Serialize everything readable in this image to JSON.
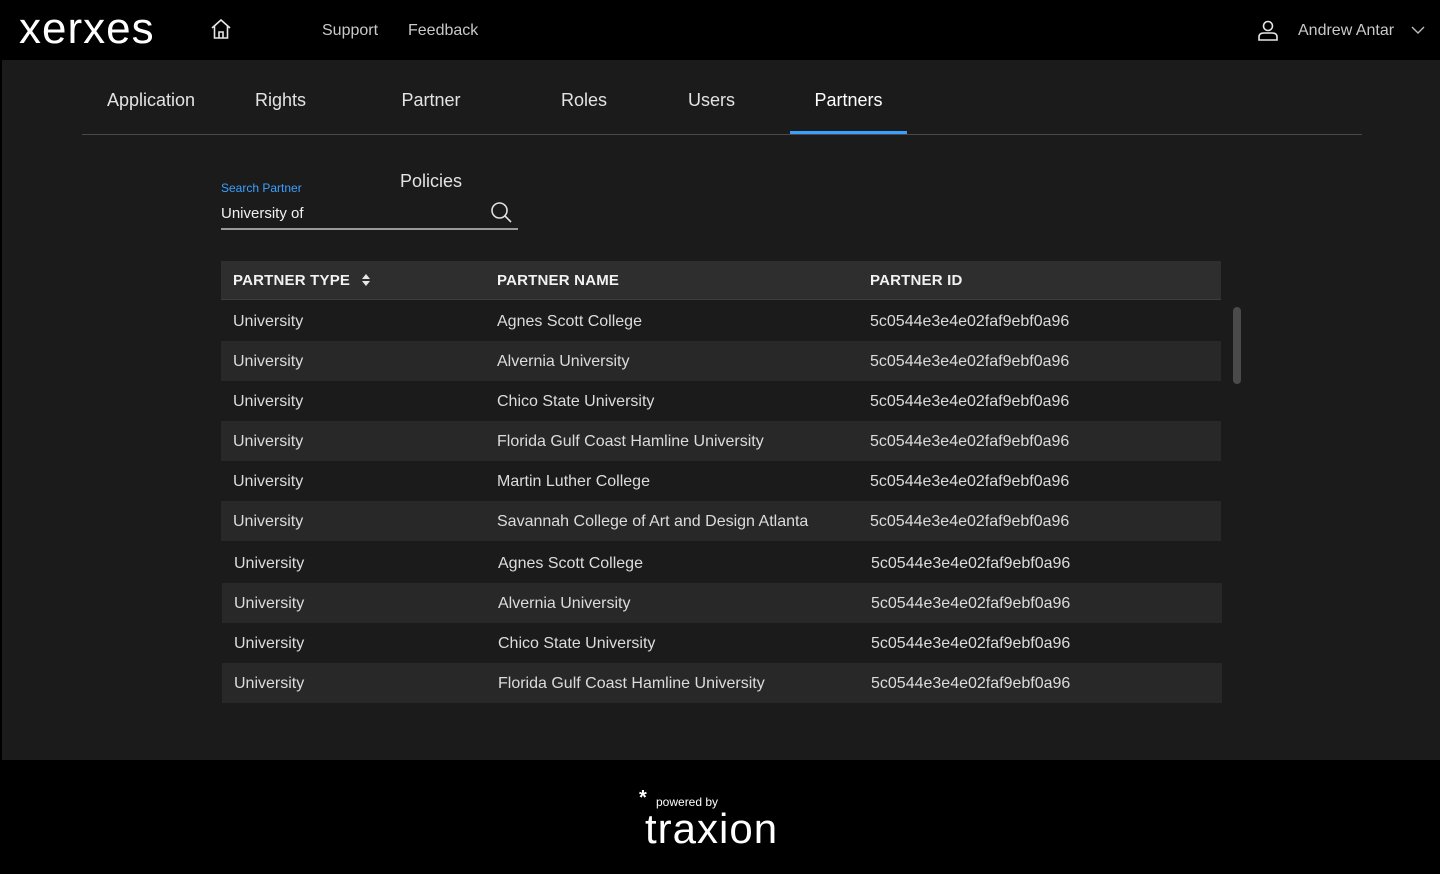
{
  "header": {
    "logo": "xerxes",
    "nav": [
      {
        "label": "Support"
      },
      {
        "label": "Feedback"
      }
    ],
    "user": {
      "name": "Andrew Antar"
    }
  },
  "tabs": [
    {
      "label": "Application"
    },
    {
      "label": "Rights"
    },
    {
      "label": "Partner Policies"
    },
    {
      "label": "Roles"
    },
    {
      "label": "Users"
    },
    {
      "label": "Partners",
      "active": true
    }
  ],
  "search": {
    "label": "Search Partner",
    "value": "University of"
  },
  "table": {
    "columns": [
      {
        "label": "PARTNER TYPE",
        "sortable": true
      },
      {
        "label": "PARTNER NAME"
      },
      {
        "label": "PARTNER ID"
      }
    ],
    "rows": [
      {
        "type": "University",
        "name": "Agnes Scott College",
        "id": "5c0544e3e4e02faf9ebf0a96"
      },
      {
        "type": "University",
        "name": "Alvernia University",
        "id": "5c0544e3e4e02faf9ebf0a96"
      },
      {
        "type": "University",
        "name": "Chico State University",
        "id": "5c0544e3e4e02faf9ebf0a96"
      },
      {
        "type": "University",
        "name": "Florida Gulf Coast Hamline University",
        "id": "5c0544e3e4e02faf9ebf0a96"
      },
      {
        "type": "University",
        "name": "Martin Luther College",
        "id": "5c0544e3e4e02faf9ebf0a96"
      },
      {
        "type": "University",
        "name": "Savannah College of Art and Design Atlanta",
        "id": "5c0544e3e4e02faf9ebf0a96"
      },
      {
        "type": "University",
        "name": "Agnes Scott College",
        "id": "5c0544e3e4e02faf9ebf0a96"
      },
      {
        "type": "University",
        "name": "Alvernia University",
        "id": "5c0544e3e4e02faf9ebf0a96"
      },
      {
        "type": "University",
        "name": "Chico State University",
        "id": "5c0544e3e4e02faf9ebf0a96"
      },
      {
        "type": "University",
        "name": "Florida Gulf Coast Hamline University",
        "id": "5c0544e3e4e02faf9ebf0a96"
      }
    ]
  },
  "footer": {
    "powered_by": "powered by",
    "brand": "traxion"
  },
  "colors": {
    "accent": "#3aa0ff",
    "background": "#1b1b1b",
    "topbar": "#000000"
  },
  "icons": [
    "home-icon",
    "user-icon",
    "chevron-down-icon",
    "search-icon",
    "sort-icon"
  ]
}
